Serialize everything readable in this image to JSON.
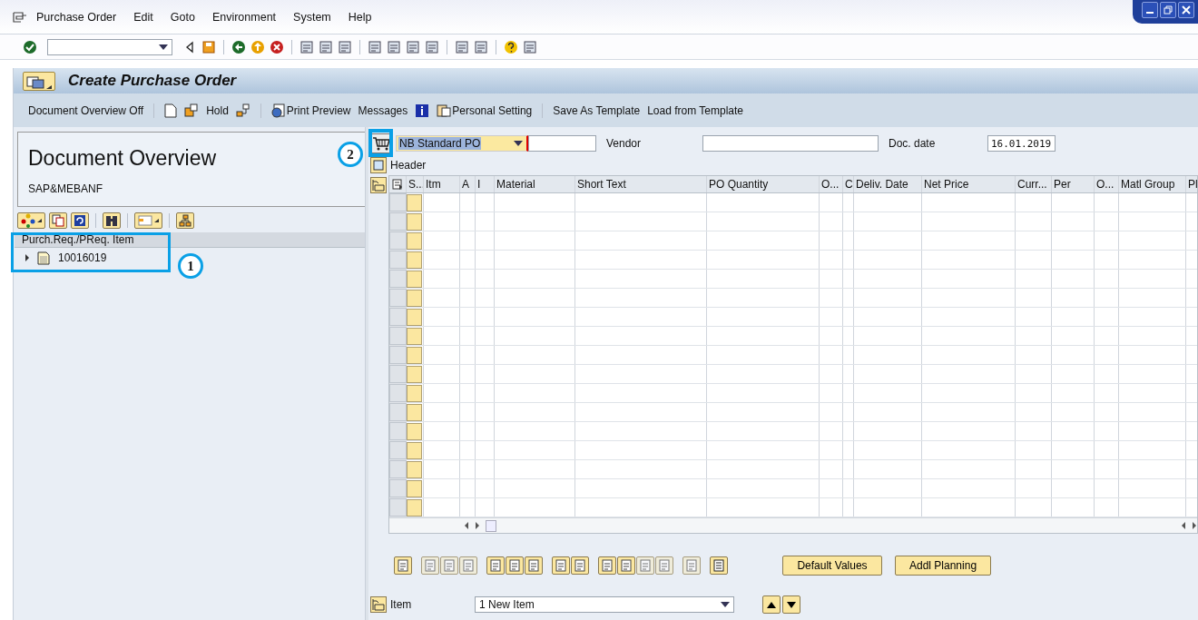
{
  "menu_bar": {
    "items": [
      "Purchase Order",
      "Edit",
      "Goto",
      "Environment",
      "System",
      "Help"
    ]
  },
  "title": "Create Purchase Order",
  "app_toolbar": [
    "Document Overview Off",
    "Hold",
    "Print Preview",
    "Messages",
    "Personal Setting",
    "Save As Template",
    "Load from Template"
  ],
  "document_overview": {
    "title": "Document Overview",
    "subtitle": "SAP&MEBANF",
    "tree": {
      "column": "Purch.Req./PReq. Item",
      "items": [
        {
          "label": "10016019",
          "expanded": false
        }
      ]
    }
  },
  "annotations": [
    {
      "label": "1"
    },
    {
      "label": "2"
    }
  ],
  "header": {
    "doc_type": "NB Standard PO",
    "vendor_label": "Vendor",
    "date_label": "Doc. date",
    "doc_date": "16.01.2019",
    "section": "Header"
  },
  "items_table": {
    "columns": [
      "S...",
      "Itm",
      "A",
      "I",
      "Material",
      "Short Text",
      "PO Quantity",
      "O...",
      "C",
      "Deliv. Date",
      "Net Price",
      "Curr...",
      "Per",
      "O...",
      "Matl Group",
      "Pl"
    ]
  },
  "buttons": [
    "Default Values",
    "Addl Planning"
  ],
  "item_selector": {
    "label": "Item",
    "value": "1 New Item"
  }
}
